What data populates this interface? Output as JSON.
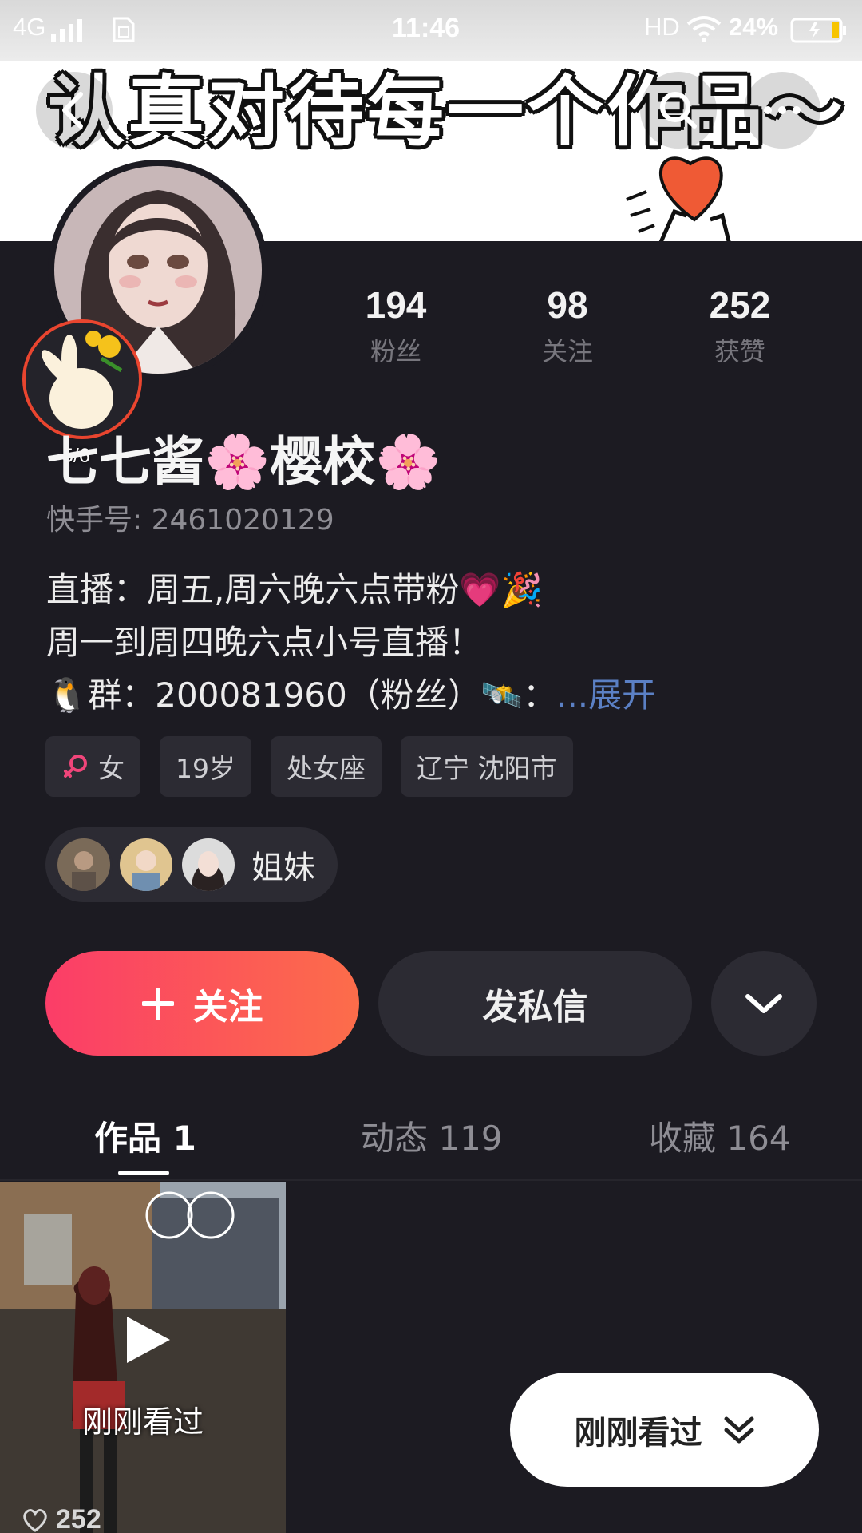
{
  "status_bar": {
    "network": "4G",
    "time": "11:46",
    "hd": "HD",
    "battery": "24%"
  },
  "banner": {
    "title": "认真对待每一个作品～"
  },
  "stats": [
    {
      "value": "194",
      "label": "粉丝"
    },
    {
      "value": "98",
      "label": "关注"
    },
    {
      "value": "252",
      "label": "获赞"
    }
  ],
  "profile": {
    "avatar_badge_count": "5/6",
    "name": "七七酱🌸樱校🌸",
    "uid": "快手号: 2461020129",
    "bio_lines": [
      "直播：周五,周六晚六点带粉💗🎉",
      "周一到周四晚六点小号直播！",
      "🐧群：200081960（粉丝）🛰️："
    ],
    "bio_expand": "...展开"
  },
  "tags": [
    {
      "icon": "female-icon",
      "label": "女"
    },
    {
      "label": "19岁"
    },
    {
      "label": "处女座"
    },
    {
      "label": "辽宁 沈阳市"
    }
  ],
  "sisters": {
    "label": "姐妹"
  },
  "actions": {
    "follow": "关注",
    "message": "发私信"
  },
  "tabs": [
    {
      "label": "作品 1",
      "active": true
    },
    {
      "label": "动态 119",
      "active": false
    },
    {
      "label": "收藏 164",
      "active": false
    }
  ],
  "works": [
    {
      "label": "刚刚看过",
      "likes": "252"
    }
  ],
  "recent_button": {
    "label": "刚刚看过"
  },
  "colors": {
    "background": "#1c1b22",
    "follow_gradient_start": "#fb3d68",
    "follow_gradient_end": "#fc6d4a",
    "link": "#5b80c4"
  }
}
